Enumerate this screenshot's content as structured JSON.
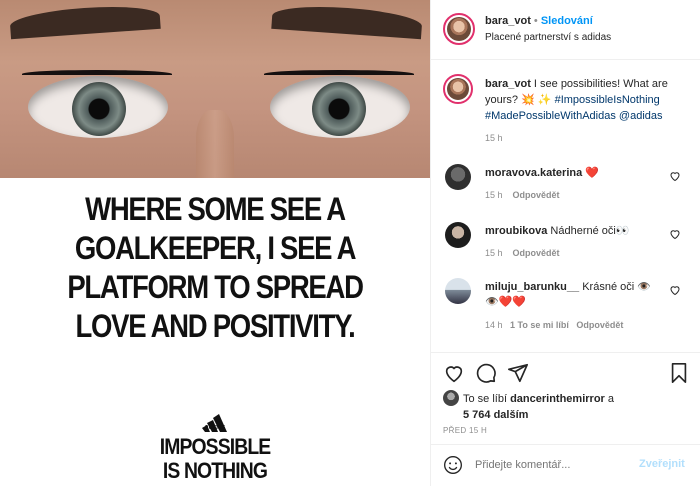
{
  "ad": {
    "headline_lines": [
      "WHERE SOME SEE A",
      "GOALKEEPER, I SEE A",
      "PLATFORM TO SPREAD",
      "LOVE AND POSITIVITY."
    ],
    "brand_word": "adidas",
    "slogan_lines": [
      "IMPOSSIBLE",
      "IS NOTHING"
    ]
  },
  "header": {
    "username": "bara_vot",
    "separator": "•",
    "follow_label": "Sledování",
    "subtitle": "Placené partnerství s adidas"
  },
  "caption": {
    "username": "bara_vot",
    "text": " I see possibilities! What are yours? 💥 ✨ ",
    "hashtag1": "#ImpossibleIsNothing",
    "hashtag2": "#MadePossibleWithAdidas",
    "mention": "@adidas",
    "time": "15 h"
  },
  "comments": [
    {
      "username": "moravova.katerina",
      "text": "❤️",
      "time": "15 h",
      "reply": "Odpovědět"
    },
    {
      "username": "mroubikova",
      "text": "Nádherné oči👀",
      "time": "15 h",
      "reply": "Odpovědět"
    },
    {
      "username": "miluju_barunku__",
      "text": "Krásné oči 👁️",
      "text2": "👁️❤️❤️",
      "time": "14 h",
      "likes": "1 To se mi líbí",
      "reply": "Odpovědět"
    }
  ],
  "likes": {
    "prefix": "To se líbí ",
    "user": "dancerinthemirror",
    "suffix": " a",
    "count": "5 764 dalším"
  },
  "posted": "PŘED 15 H",
  "comment_input": {
    "placeholder": "Přidejte komentář...",
    "post_label": "Zveřejnit"
  },
  "colors": {
    "accent": "#0095f6",
    "heart_red": "#ed4956",
    "text": "#262626",
    "muted": "#8e8e8e"
  },
  "icons": [
    "heart-icon",
    "comment-icon",
    "share-icon",
    "bookmark-icon",
    "emoji-icon",
    "more-icon"
  ]
}
